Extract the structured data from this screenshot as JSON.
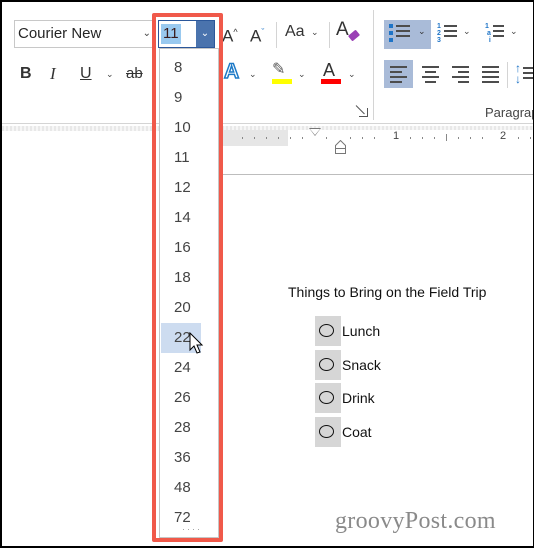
{
  "ribbon": {
    "font_name": "Courier New",
    "font_size": "11",
    "buttons": {
      "bold": "B",
      "italic": "I",
      "underline": "U",
      "strikethrough": "ab",
      "grow_font": "A",
      "shrink_font": "A",
      "change_case": "Aa",
      "clear_formatting": "A",
      "text_effects": "A",
      "highlight": "✎",
      "font_color": "A"
    },
    "colors": {
      "highlight": "#ffff00",
      "font_color": "#ff0000",
      "selected_bg": "#a9bbd8",
      "accent": "#2b579a"
    },
    "group_labels": {
      "paragraph": "Paragraph"
    }
  },
  "ruler": {
    "labels": [
      "1",
      "2"
    ]
  },
  "font_size_dropdown": {
    "options": [
      "8",
      "9",
      "10",
      "11",
      "12",
      "14",
      "16",
      "18",
      "20",
      "22",
      "24",
      "26",
      "28",
      "36",
      "48",
      "72"
    ],
    "hovered": "22",
    "highlight_color": "#f0594a"
  },
  "document": {
    "title": "Things to Bring on the Field Trip",
    "items": [
      "Lunch",
      "Snack",
      "Drink",
      "Coat"
    ]
  },
  "watermark": "groovyPost.com"
}
